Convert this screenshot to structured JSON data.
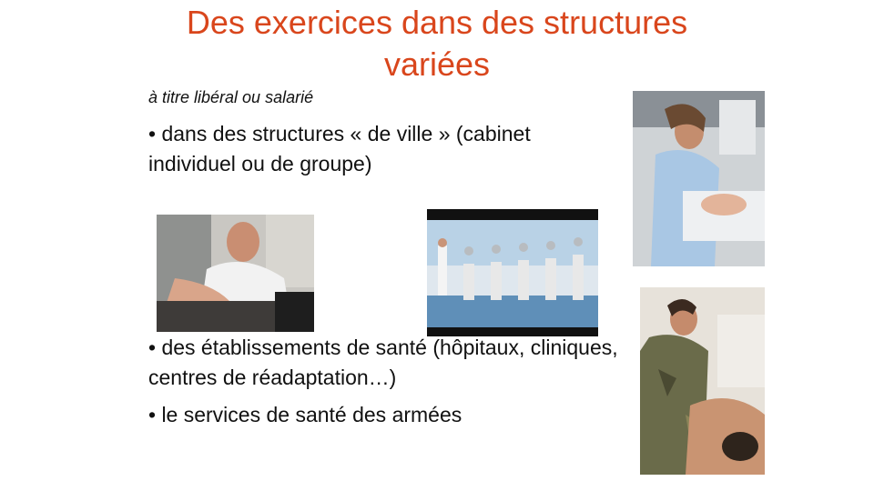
{
  "slide": {
    "title_line1": "Des exercices dans des structures",
    "title_line2": "variées",
    "subtitle": "à titre libéral ou salarié",
    "bullets": [
      "• dans des structures « de ville » (cabinet individuel ou de groupe)",
      "• des établissements de santé (hôpitaux, cliniques, centres de réadaptation…)",
      "• le services de santé des armées"
    ]
  },
  "colors": {
    "title": "#d9461c"
  },
  "images": [
    {
      "name": "physio-cabinet-photo"
    },
    {
      "name": "rehab-gym-photo"
    },
    {
      "name": "neonatal-care-photo"
    },
    {
      "name": "military-massage-photo"
    }
  ]
}
